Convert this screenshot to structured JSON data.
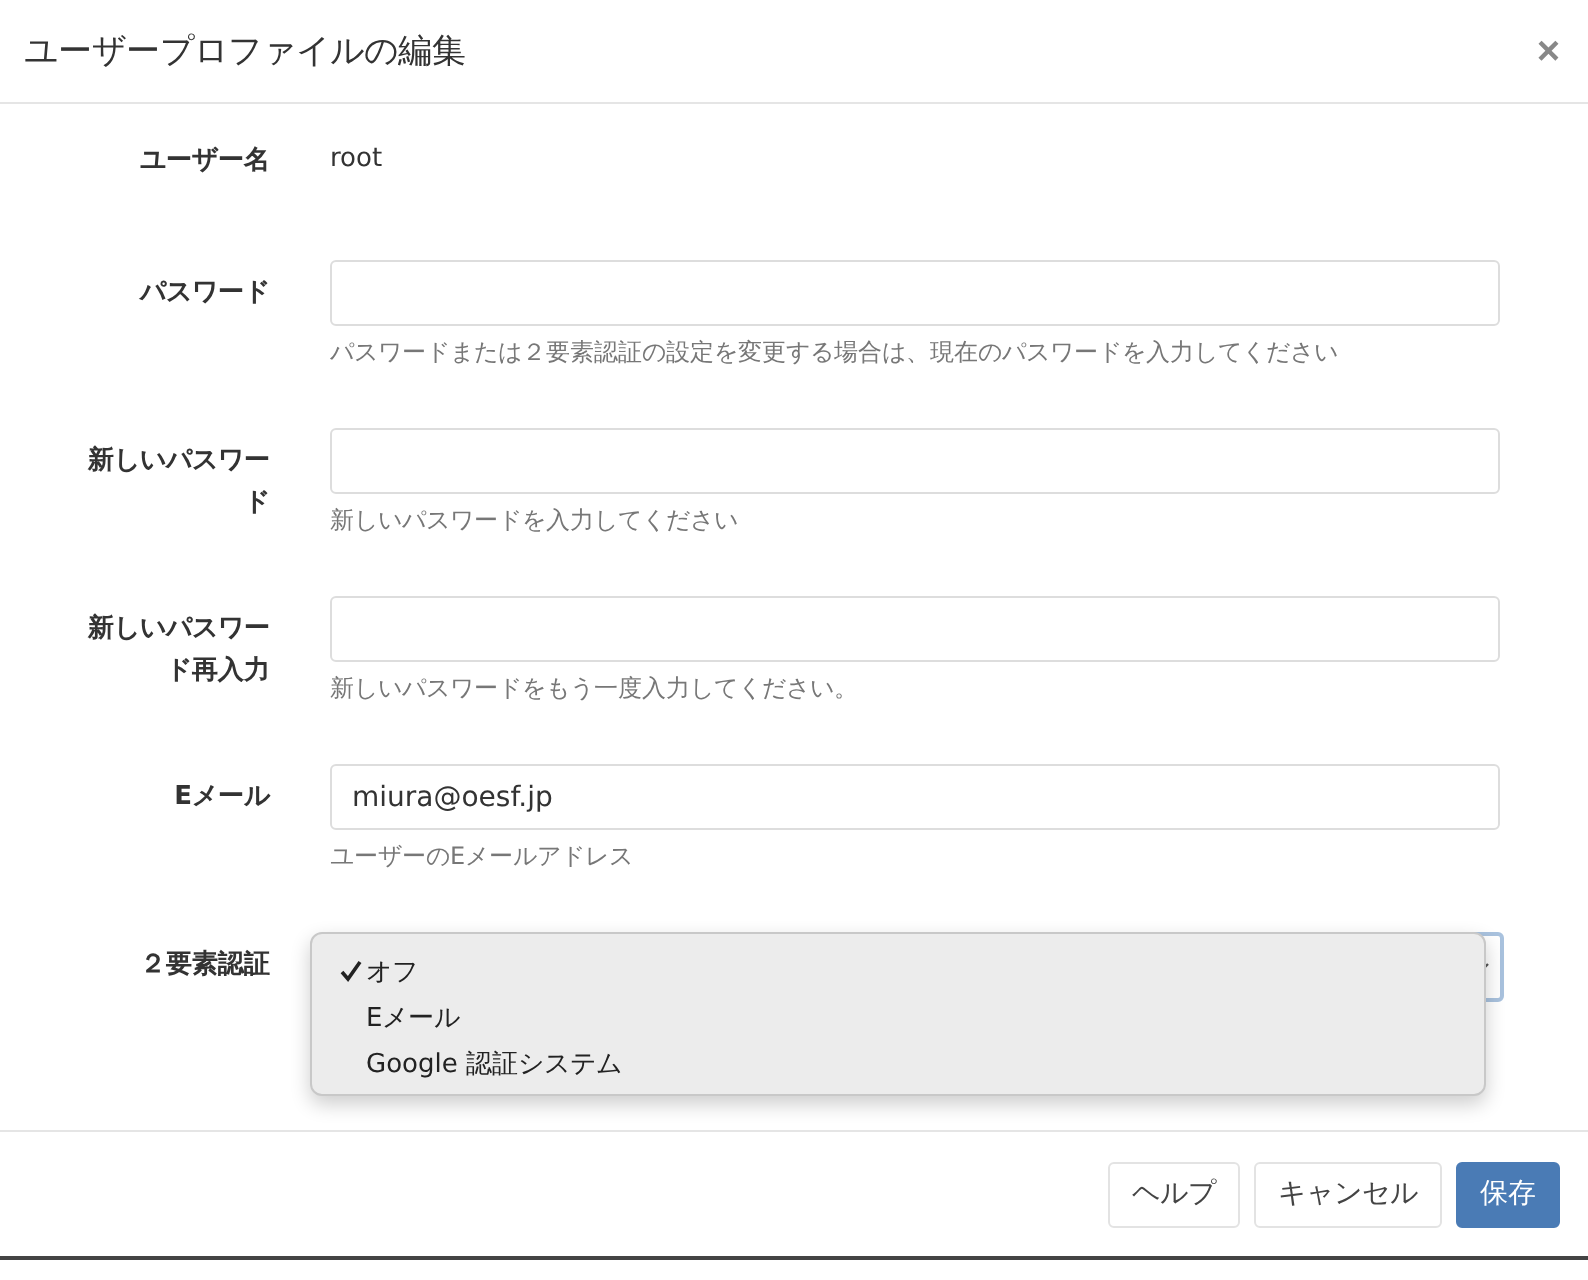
{
  "dialog": {
    "title": "ユーザープロファイルの編集",
    "close": "×"
  },
  "fields": [
    {
      "kind": "static",
      "label": "ユーザー名",
      "value": "root"
    },
    {
      "kind": "input",
      "label": "パスワード",
      "help": "パスワードまたは２要素認証の設定を変更する場合は、現在のパスワードを入力してください"
    },
    {
      "kind": "input",
      "label": "新しいパスワード",
      "help": "新しいパスワードを入力してください"
    },
    {
      "kind": "input",
      "label": "新しいパスワード再入力",
      "help": "新しいパスワードをもう一度入力してください。"
    },
    {
      "kind": "input",
      "label": "Eメール",
      "value": "miura@oesf.jp",
      "help": "ユーザーのEメールアドレス"
    },
    {
      "kind": "select",
      "label": "２要素認証",
      "expanded": true,
      "options": [
        {
          "label": "オフ",
          "selected": true
        },
        {
          "label": "Eメール",
          "selected": false
        },
        {
          "label": "Google 認証システム",
          "selected": false
        }
      ]
    }
  ],
  "buttons": [
    {
      "label": "ヘルプ",
      "kind": "default"
    },
    {
      "label": "キャンセル",
      "kind": "default"
    },
    {
      "label": "保存",
      "kind": "primary"
    }
  ]
}
